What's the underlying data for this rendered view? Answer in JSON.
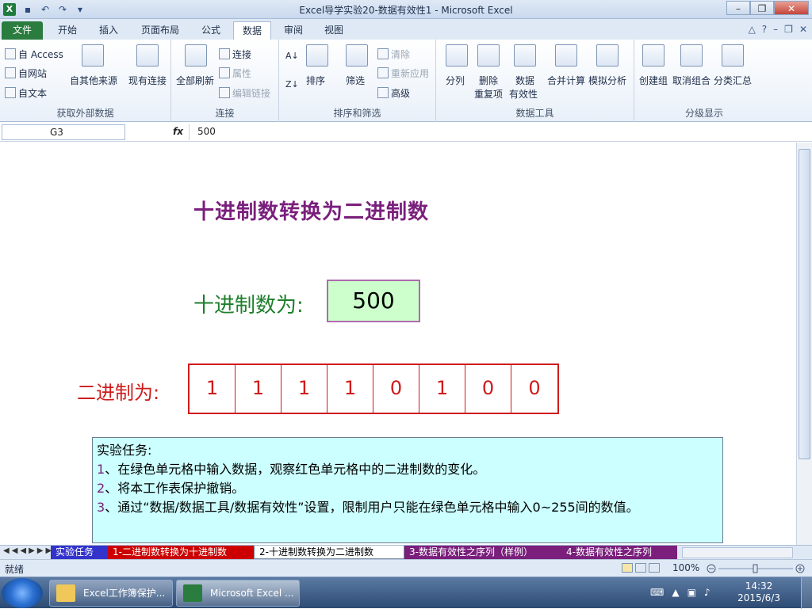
{
  "window": {
    "title": "Excel导学实验20-数据有效性1 - Microsoft Excel"
  },
  "ribbon_tabs": [
    "文件",
    "开始",
    "插入",
    "页面布局",
    "公式",
    "数据",
    "审阅",
    "视图"
  ],
  "ribbon": {
    "external": {
      "access": "自 Access",
      "web": "自网站",
      "text": "自文本",
      "other": "自其他来源",
      "existing": "现有连接",
      "label": "获取外部数据"
    },
    "connections": {
      "refresh": "全部刷新",
      "connections": "连接",
      "properties": "属性",
      "edit_links": "编辑链接",
      "label": "连接"
    },
    "sort_filter": {
      "sort_az": "A↓Z",
      "sort": "排序",
      "filter": "筛选",
      "clear": "清除",
      "reapply": "重新应用",
      "advanced": "高级",
      "label": "排序和筛选"
    },
    "data_tools": {
      "text_to_cols": "分列",
      "remove_dup_1": "删除",
      "remove_dup_2": "重复项",
      "validation_1": "数据",
      "validation_2": "有效性",
      "consolidate": "合并计算",
      "whatif": "模拟分析",
      "label": "数据工具"
    },
    "outline": {
      "group": "创建组",
      "ungroup": "取消组合",
      "subtotal": "分类汇总",
      "label": "分级显示"
    }
  },
  "formula_bar": {
    "cell": "G3",
    "fx": "fx",
    "value": "500"
  },
  "sheet": {
    "title": "十进制数转换为二进制数",
    "decimal_label": "十进制数为:",
    "decimal_value": "500",
    "binary_label": "二进制为:",
    "binary_digits": [
      "1",
      "1",
      "1",
      "1",
      "0",
      "1",
      "0",
      "0"
    ],
    "task_title": "实验任务:",
    "tasks": [
      {
        "num": "1",
        "text": "、在绿色单元格中输入数据，观察红色单元格中的二进制数的变化。"
      },
      {
        "num": "2",
        "text": "、将本工作表保护撤销。"
      },
      {
        "num": "3",
        "text": "、通过“数据/数据工具/数据有效性”设置，限制用户只能在绿色单元格中输入0~255间的数值。"
      }
    ]
  },
  "sheet_tabs": [
    {
      "label": "实验任务",
      "color": "#3333cc",
      "text": "#ffffff"
    },
    {
      "label": "1-二进制数转换为十进制数",
      "color": "#cc0000",
      "text": "#ffffff"
    },
    {
      "label": "2-十进制数转换为二进制数",
      "color": "#ffffff",
      "text": "#000000"
    },
    {
      "label": "3-数据有效性之序列（样例）",
      "color": "#7a1f7c",
      "text": "#ffffff"
    },
    {
      "label": "4-数据有效性之序列",
      "color": "#7a1f7c",
      "text": "#ffffff"
    }
  ],
  "status": {
    "ready": "就绪",
    "zoom": "100%"
  },
  "taskbar": {
    "items": [
      {
        "label": "Excel工作簿保护..."
      },
      {
        "label": "Microsoft Excel ..."
      }
    ],
    "time": "14:32",
    "date": "2015/6/3"
  },
  "colors": {
    "green_cell": "#ccffcc",
    "red": "#d01b1b",
    "purple": "#7a1f7c",
    "note_bg": "#ccffff",
    "excel_green": "#2a7c3f"
  }
}
